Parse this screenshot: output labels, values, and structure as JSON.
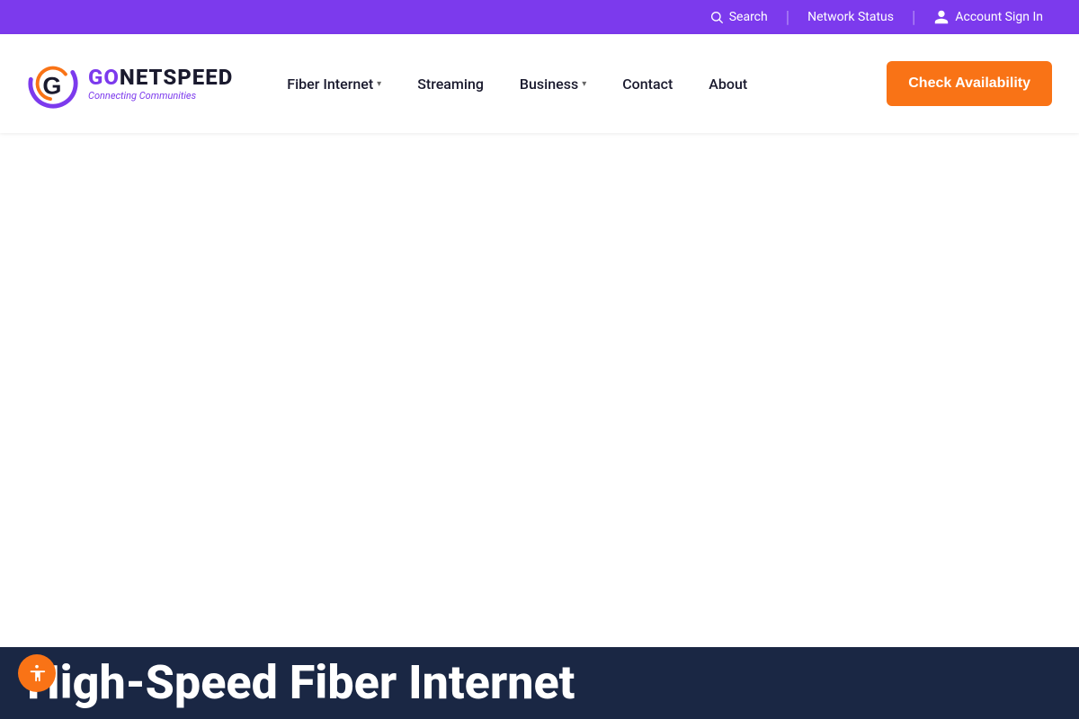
{
  "top_bar": {
    "search_placeholder": "Search",
    "network_status_label": "Network Status",
    "account_sign_in_label": "Account Sign In"
  },
  "navbar": {
    "logo": {
      "go_text": "GO",
      "netspeed_text": "NETSPEED",
      "tagline": "Connecting Communities"
    },
    "nav_links": [
      {
        "label": "Fiber Internet",
        "has_dropdown": true
      },
      {
        "label": "Streaming",
        "has_dropdown": false
      },
      {
        "label": "Business",
        "has_dropdown": true
      },
      {
        "label": "Contact",
        "has_dropdown": false
      },
      {
        "label": "About",
        "has_dropdown": false
      }
    ],
    "cta_button_label": "Check Availability"
  },
  "hero": {
    "title": "High-Speed Fiber Internet"
  },
  "accessibility": {
    "button_label": "Accessibility"
  },
  "colors": {
    "purple": "#7c3aed",
    "orange": "#f97316",
    "dark_navy": "#1a2744",
    "dark_text": "#1a1a2e"
  }
}
